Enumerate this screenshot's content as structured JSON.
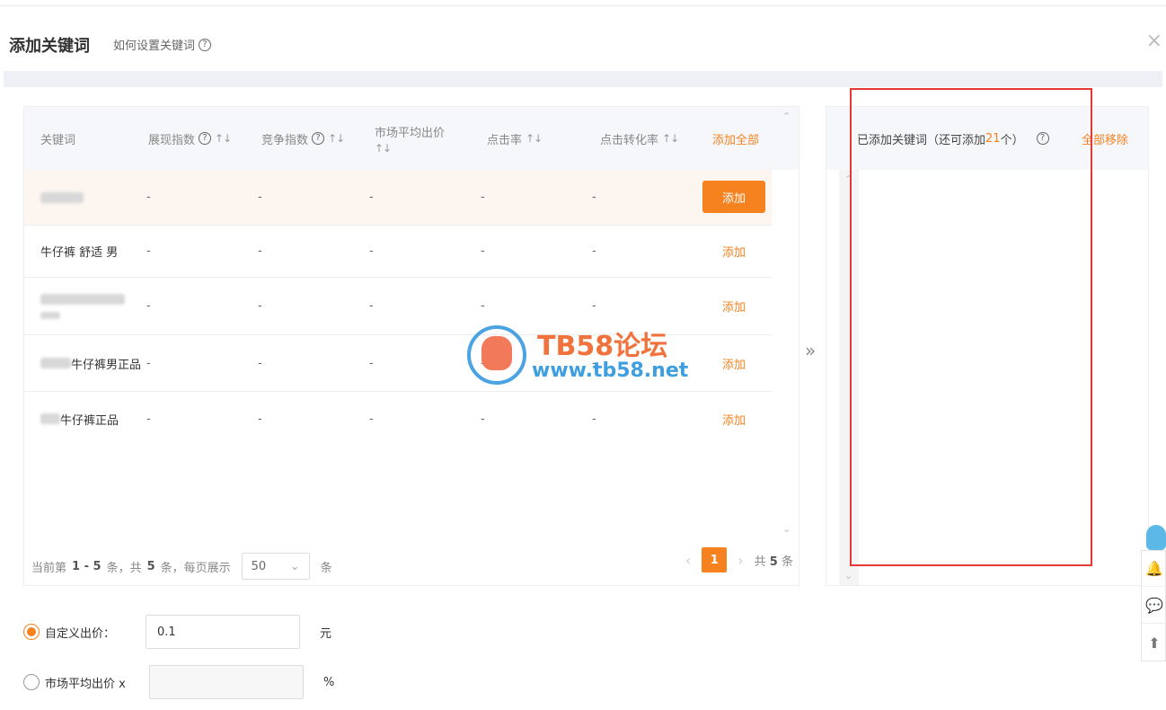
{
  "header": {
    "title": "添加关键词",
    "help_link": "如何设置关键词",
    "close_glyph": "×"
  },
  "table": {
    "columns": [
      {
        "label": "关键词",
        "sort": false,
        "help": false
      },
      {
        "label": "展现指数",
        "sort": true,
        "help": true
      },
      {
        "label": "竞争指数",
        "sort": true,
        "help": true
      },
      {
        "label": "市场平均出价",
        "sort": true,
        "help": false
      },
      {
        "label": "点击率",
        "sort": true,
        "help": false
      },
      {
        "label": "点击转化率",
        "sort": true,
        "help": false
      }
    ],
    "add_all": "添加全部",
    "rows": [
      {
        "keyword": "",
        "values": [
          "-",
          "-",
          "-",
          "-",
          "-"
        ],
        "action": "添加",
        "highlighted": true
      },
      {
        "keyword": "牛仔裤 舒适 男",
        "values": [
          "-",
          "-",
          "-",
          "-",
          "-"
        ],
        "action": "添加",
        "highlighted": false
      },
      {
        "keyword": "",
        "values": [
          "-",
          "-",
          "-",
          "-",
          "-"
        ],
        "action": "添加",
        "highlighted": false
      },
      {
        "keyword": "牛仔裤男正品",
        "values": [
          "-",
          "-",
          "-",
          "-",
          "-"
        ],
        "action": "添加",
        "highlighted": false
      },
      {
        "keyword": "牛仔裤正品",
        "values": [
          "-",
          "-",
          "-",
          "-",
          "-"
        ],
        "action": "添加",
        "highlighted": false
      }
    ]
  },
  "pager": {
    "prefix": "当前第",
    "range": "1 - 5",
    "mid1": "条，共",
    "total": "5",
    "mid2": "条，每页展示",
    "page_size": "50",
    "suffix": "条",
    "current_page": "1",
    "total_label_prefix": "共",
    "total_label_num": "5",
    "total_label_suffix": "条"
  },
  "right": {
    "title_prefix": "已添加关键词（还可添加",
    "remaining": "21",
    "title_suffix": "个）",
    "remove_all": "全部移除"
  },
  "bid": {
    "custom_label": "自定义出价：",
    "custom_value": "0.1",
    "custom_unit": "元",
    "market_label": "市场平均出价 x",
    "market_value": "",
    "market_unit": "%"
  },
  "watermark": {
    "title": "TB58论坛",
    "url": "www.tb58.net"
  },
  "colors": {
    "accent": "#f5821f",
    "highlight_box": "#e53935"
  }
}
